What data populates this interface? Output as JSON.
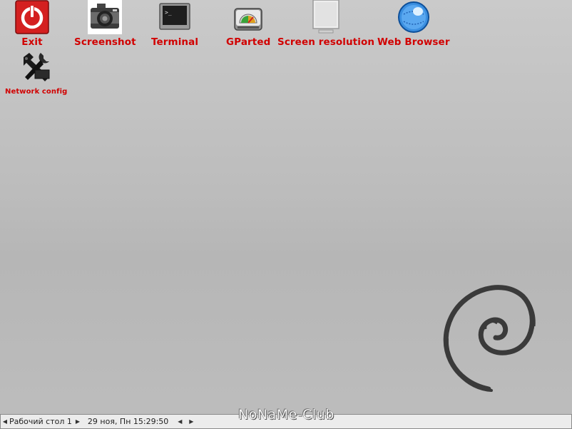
{
  "desktop_icons": [
    {
      "label": "Exit",
      "icon": "power-icon"
    },
    {
      "label": "Screenshot",
      "icon": "camera-icon"
    },
    {
      "label": "Terminal",
      "icon": "terminal-icon"
    },
    {
      "label": "GParted",
      "icon": "disk-icon"
    },
    {
      "label": "Screen resolution",
      "icon": "monitor-icon"
    },
    {
      "label": "Web Browser",
      "icon": "globe-icon"
    },
    {
      "label": "Network config",
      "icon": "wrench-icon"
    }
  ],
  "taskbar": {
    "workspace": "Рабочий стол 1",
    "clock": "29 ноя, Пн 15:29:50"
  },
  "watermark": "NoNaMe-Club",
  "colors": {
    "label": "#d10000",
    "desktop_bg": "#bdbdbd",
    "taskbar_bg": "#ececec",
    "swirl": "#3a3a3a"
  }
}
